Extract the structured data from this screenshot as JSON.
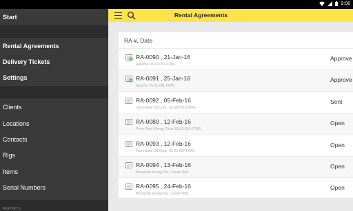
{
  "status_bar": {
    "time": "9:08",
    "icons": [
      "wifi-icon",
      "signal-icon",
      "battery-icon"
    ]
  },
  "colors": {
    "header": "#ffe34a",
    "sidebar": "#3a3a3a",
    "approved_check": "#4caf50"
  },
  "sidebar": {
    "top_items": [
      "Start",
      "Rental Agreements",
      "Delivery Tickets",
      "Settings"
    ],
    "items": [
      "Clients",
      "Locations",
      "Contacts",
      "Rigs",
      "Items",
      "Serial Numbers"
    ],
    "section_label": "REPORTS"
  },
  "header": {
    "title": "Rental Agreements",
    "icons": [
      "menu-icon",
      "search-icon"
    ]
  },
  "list": {
    "column_header": "RA #, Date",
    "rows": [
      {
        "id": "RA-0090",
        "date": "21-Jan-16",
        "sub": "Apache, 03-10-051-02W6",
        "status": "Approve",
        "icon": "approved-document-icon"
      },
      {
        "id": "RA-0091",
        "date": "25-Jan-16",
        "sub": "Apache, 01-11-041-05W1",
        "status": "Approve",
        "icon": "approved-document-icon"
      },
      {
        "id": "RA-0092",
        "date": "05-Feb-16",
        "sub": "Tourmaline Oil Corp., 03-18-071-07W4",
        "status": "Sent",
        "icon": "document-icon"
      },
      {
        "id": "RA-0080",
        "date": "12-Feb-16",
        "sub": "Penn West Energy Trust, 05-02-011-07W5",
        "status": "Open",
        "icon": "document-icon"
      },
      {
        "id": "RA-0093",
        "date": "12-Feb-16",
        "sub": "Tourmaline Oil Corp., 05-21-007-04W1",
        "status": "Open",
        "icon": "document-icon"
      },
      {
        "id": "RA-0094",
        "date": "13-Feb-16",
        "sub": "Bonavista Energy Inc., Green Well",
        "status": "Open",
        "icon": "document-icon"
      },
      {
        "id": "RA-0095",
        "date": "24-Feb-16",
        "sub": "Bonavista Energy Inc., Green Well",
        "status": "Open",
        "icon": "document-icon"
      }
    ]
  }
}
